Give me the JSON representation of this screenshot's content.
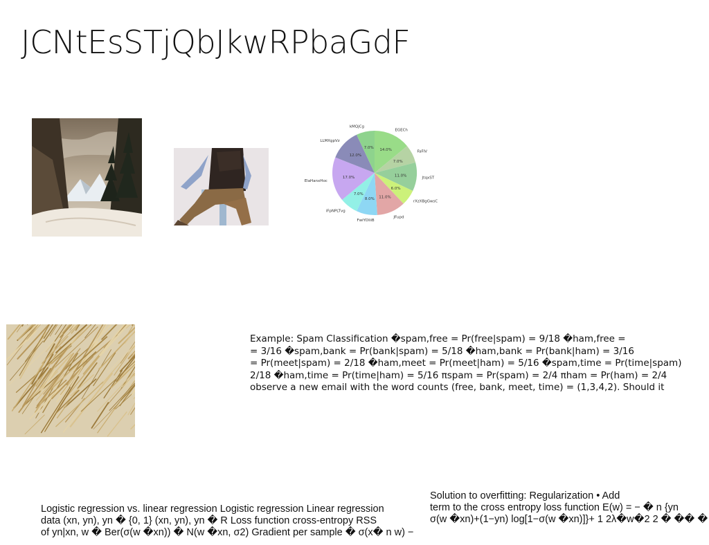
{
  "title": "JCNtEsSTjQbJkwRPbaGdF",
  "images": {
    "mountain": "snowy-mountain-forest-photo",
    "person": "seated-person-photo",
    "straw": "dried-straw-photo"
  },
  "chart_data": {
    "type": "pie",
    "title": "",
    "categories": [
      "EGECh",
      "FaFIV",
      "JtqxST",
      "rXzXBgGwsC",
      "JFupd",
      "FwiYDliiB",
      "iFpNPLTvg",
      "ElaHanxHoc",
      "LLMXgpVz",
      "kMQjCg"
    ],
    "values": [
      14.0,
      7.0,
      11.0,
      6.0,
      11.0,
      8.0,
      7.0,
      17.0,
      12.0,
      7.0
    ],
    "labels": [
      "14.0%",
      "7.0%",
      "11.0%",
      "6.0%",
      "11.0%",
      "8.0%",
      "7.0%",
      "17.0%",
      "12.0%",
      "7.0%"
    ],
    "colors": [
      "#99dc88",
      "#b6d3a4",
      "#96cf9b",
      "#ccf17a",
      "#e2a6a6",
      "#8ed7f4",
      "#93f0e6",
      "#c7a7f0",
      "#8a8bb8",
      "#8ed38d"
    ]
  },
  "spam_example": {
    "lines": [
      "Example: Spam Classification �spam,free = Pr(free|spam) = 9/18 �ham,free =",
      "= 3/16 �spam,bank = Pr(bank|spam) = 5/18 �ham,bank = Pr(bank|ham) = 3/16",
      "= Pr(meet|spam) = 2/18 �ham,meet = Pr(meet|ham) = 5/16 �spam,time = Pr(time|spam)",
      "2/18 �ham,time = Pr(time|ham) = 5/16 πspam = Pr(spam) = 2/4 πham = Pr(ham) = 2/4",
      "observe a new email with the word counts (free, bank, meet, time) = (1,3,4,2). Should it"
    ]
  },
  "logistic": {
    "lines": [
      "Logistic regression vs. linear regression Logistic regression Linear regression",
      "data (xn, yn), yn � {0, 1} (xn, yn), yn � R Loss function cross-entropy RSS",
      "of yn|xn, w � Ber(σ(w �xn)) � N(w �xn, σ2) Gradient per sample � σ(x� n w) −"
    ]
  },
  "overfitting": {
    "lines": [
      "Solution to overfitting: Regularization • Add",
      "term to the cross entropy loss function E(w) = − � n {yn",
      "σ(w �xn)+(1−yn) log[1−σ(w �xn)]}+ 1 2λ�w�2 2 � �� �"
    ]
  }
}
